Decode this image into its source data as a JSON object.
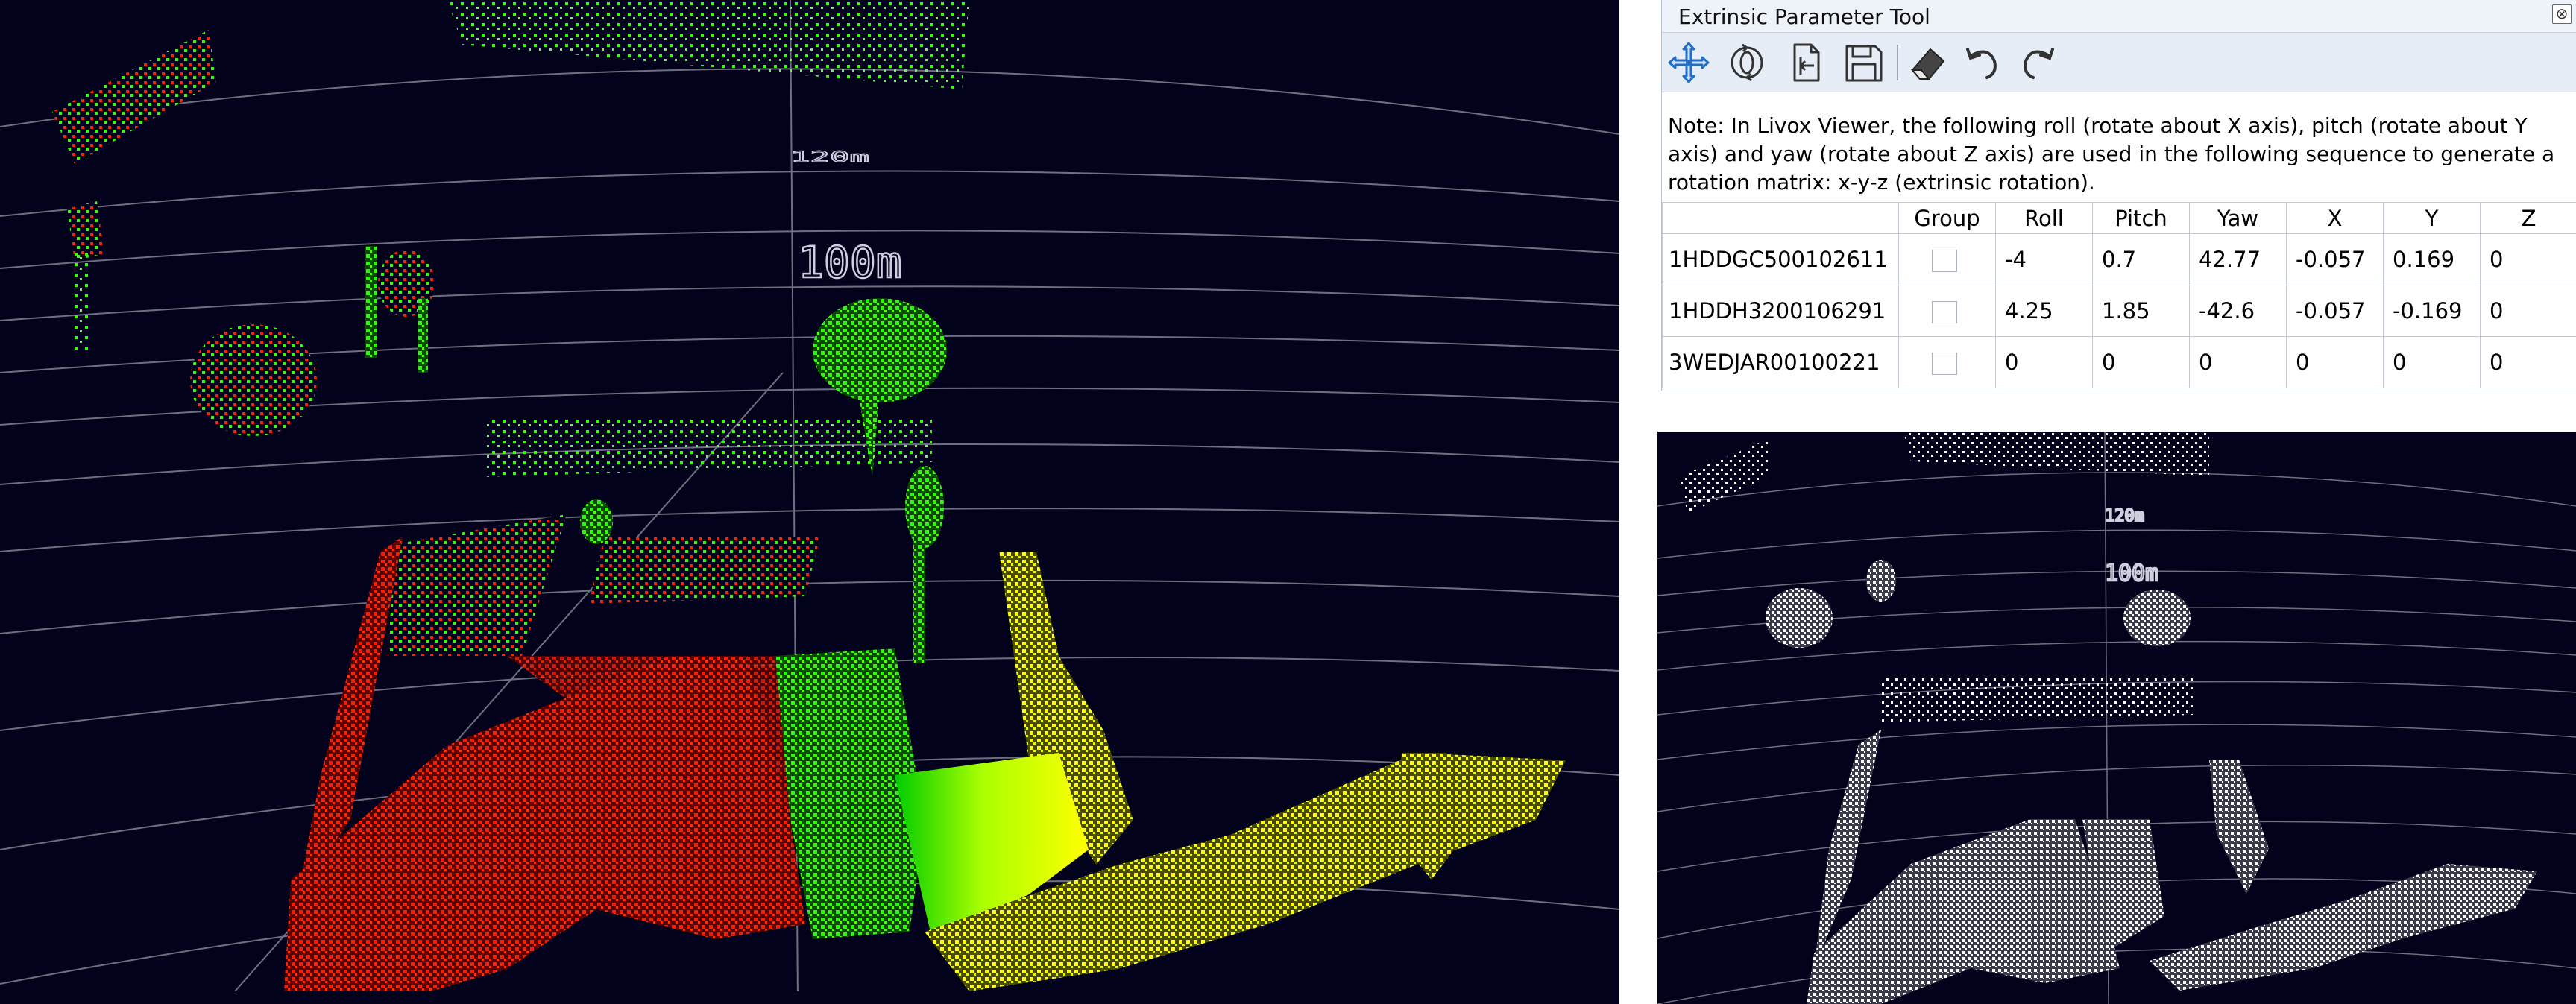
{
  "panel": {
    "title": "Extrinsic Parameter Tool",
    "close_glyph": "⊗",
    "toolbar": [
      {
        "name": "move-icon",
        "tooltip": ""
      },
      {
        "name": "rotate-icon",
        "tooltip": ""
      },
      {
        "name": "import-icon",
        "tooltip": ""
      },
      {
        "name": "save-icon",
        "tooltip": ""
      },
      {
        "name": "eraser-icon",
        "tooltip": ""
      },
      {
        "name": "undo-icon",
        "tooltip": ""
      },
      {
        "name": "redo-icon",
        "tooltip": ""
      }
    ],
    "note": "Note: In Livox Viewer, the following roll (rotate about X axis), pitch (rotate about Y axis) and yaw (rotate about Z axis) are used in the following sequence to generate a rotation matrix: x-y-z (extrinsic rotation).",
    "columns": [
      "",
      "Group",
      "Roll",
      "Pitch",
      "Yaw",
      "X",
      "Y",
      "Z"
    ],
    "rows": [
      {
        "sn": "1HDDGC500102611",
        "group": false,
        "roll": "-4",
        "pitch": "0.7",
        "yaw": "42.77",
        "x": "-0.057",
        "y": "0.169",
        "z": "0"
      },
      {
        "sn": "1HDDH3200106291",
        "group": false,
        "roll": "4.25",
        "pitch": "1.85",
        "yaw": "-42.6",
        "x": "-0.057",
        "y": "-0.169",
        "z": "0"
      },
      {
        "sn": "3WEDJAR00100221",
        "group": false,
        "roll": "0",
        "pitch": "0",
        "yaw": "0",
        "x": "0",
        "y": "0",
        "z": "0"
      }
    ]
  },
  "viewer_main": {
    "distance_labels": [
      "120m",
      "100m"
    ],
    "colors": {
      "background": "#02021c",
      "grid": "#9a9aa6",
      "lidar_1": "#ff0000",
      "lidar_2": "#00ff00",
      "lidar_3": "#ffff00"
    }
  },
  "viewer_mono": {
    "distance_labels": [
      "120m",
      "100m"
    ],
    "colors": {
      "background": "#02021c",
      "grid": "#9a9aa6",
      "points": "#ffffff"
    }
  },
  "colors": {
    "accent": "#1f6fc9",
    "toolbar_bg": "#e7edf6",
    "title_bg": "#eef3f9"
  }
}
